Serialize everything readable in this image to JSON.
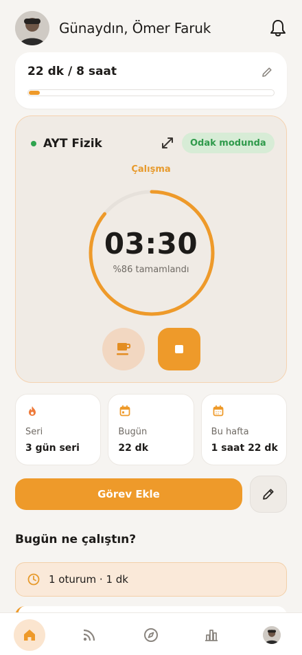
{
  "header": {
    "greeting": "Günaydın, Ömer Faruk",
    "avatar_icon": "user-avatar",
    "bell_icon": "bell-icon"
  },
  "goal": {
    "text": "22 dk / 8 saat",
    "progress_fraction": 0.046,
    "edit_icon": "pencil-icon"
  },
  "timer": {
    "subject": "AYT Fizik",
    "status_badge": "Odak modunda",
    "mode": "Çalışma",
    "time": "03:30",
    "percent_text": "%86 tamamlandı",
    "ring_progress": 0.86,
    "break_icon": "coffee-cup-icon",
    "stop_icon": "stop-icon"
  },
  "stats": [
    {
      "icon": "flame-icon",
      "label": "Seri",
      "value": "3 gün seri"
    },
    {
      "icon": "calendar-icon",
      "label": "Bugün",
      "value": "22 dk"
    },
    {
      "icon": "calendar-icon",
      "label": "Bu hafta",
      "value": "1 saat 22 dk"
    }
  ],
  "actions": {
    "add_task": "Görev Ekle",
    "edit_icon": "pencil-icon"
  },
  "today": {
    "title": "Bugün ne çalıştın?",
    "session_text": "1 oturum · 1 dk"
  },
  "nav": {
    "items": [
      "home-icon",
      "feed-icon",
      "compass-icon",
      "chart-icon",
      "profile-avatar"
    ]
  },
  "colors": {
    "accent": "#ee9a2a",
    "success": "#2fa44f",
    "background": "#f6f4f1"
  }
}
